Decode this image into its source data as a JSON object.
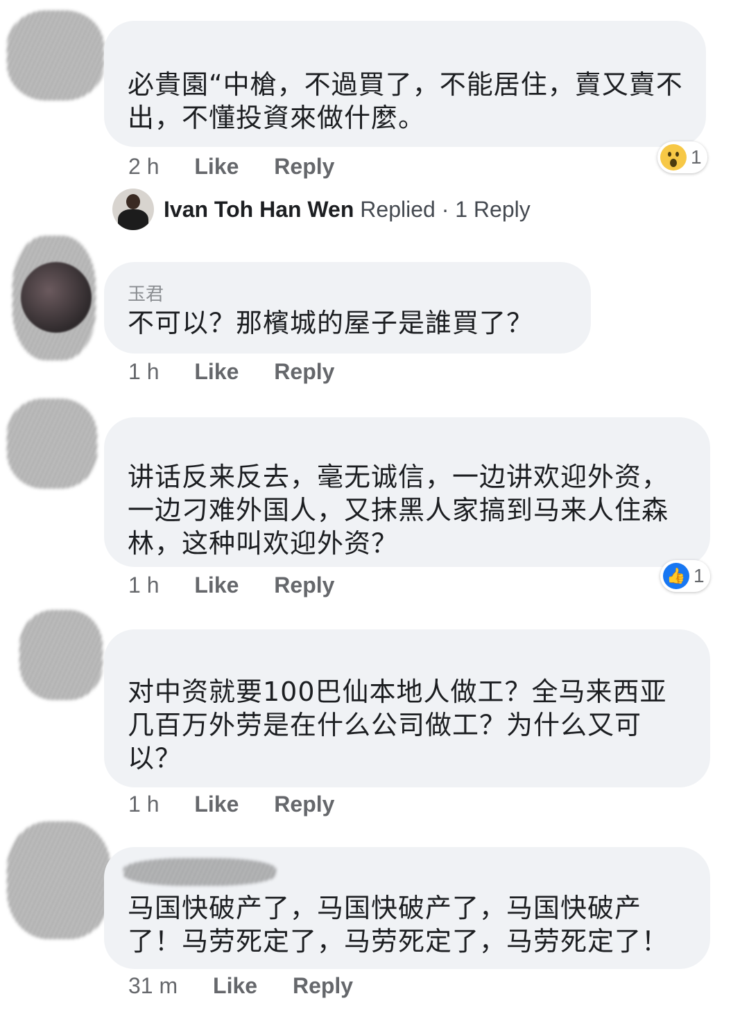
{
  "comments": [
    {
      "name": "",
      "text": "必貴園“中槍，不過買了，不能居住，賣又賣不出，不懂投資來做什麼。",
      "time": "2 h",
      "like": "Like",
      "reply": "Reply",
      "reaction": {
        "icon": "wow-icon",
        "count": "1"
      }
    },
    {
      "name": "玉君",
      "text": "不可以？那檳城的屋子是誰買了？",
      "time": "1 h",
      "like": "Like",
      "reply": "Reply"
    },
    {
      "name": "",
      "text": "讲话反来反去，毫无诚信，一边讲欢迎外资，一边刁难外国人，又抹黑人家搞到马来人住森林，这种叫欢迎外资？",
      "time": "1 h",
      "like": "Like",
      "reply": "Reply",
      "reaction": {
        "icon": "like-icon",
        "count": "1"
      }
    },
    {
      "name": "",
      "text": "对中资就要100巴仙本地人做工？全马来西亚几百万外劳是在什么公司做工？为什么又可以？",
      "time": "1 h",
      "like": "Like",
      "reply": "Reply"
    },
    {
      "name": "",
      "text": "马国快破产了，马国快破产了，马国快破产了！马劳死定了，马劳死定了，马劳死定了！",
      "time": "31 m",
      "like": "Like",
      "reply": "Reply"
    }
  ],
  "replied": {
    "name": "Ivan Toh Han Wen",
    "verb": "Replied",
    "sep": "·",
    "count": "1 Reply"
  }
}
